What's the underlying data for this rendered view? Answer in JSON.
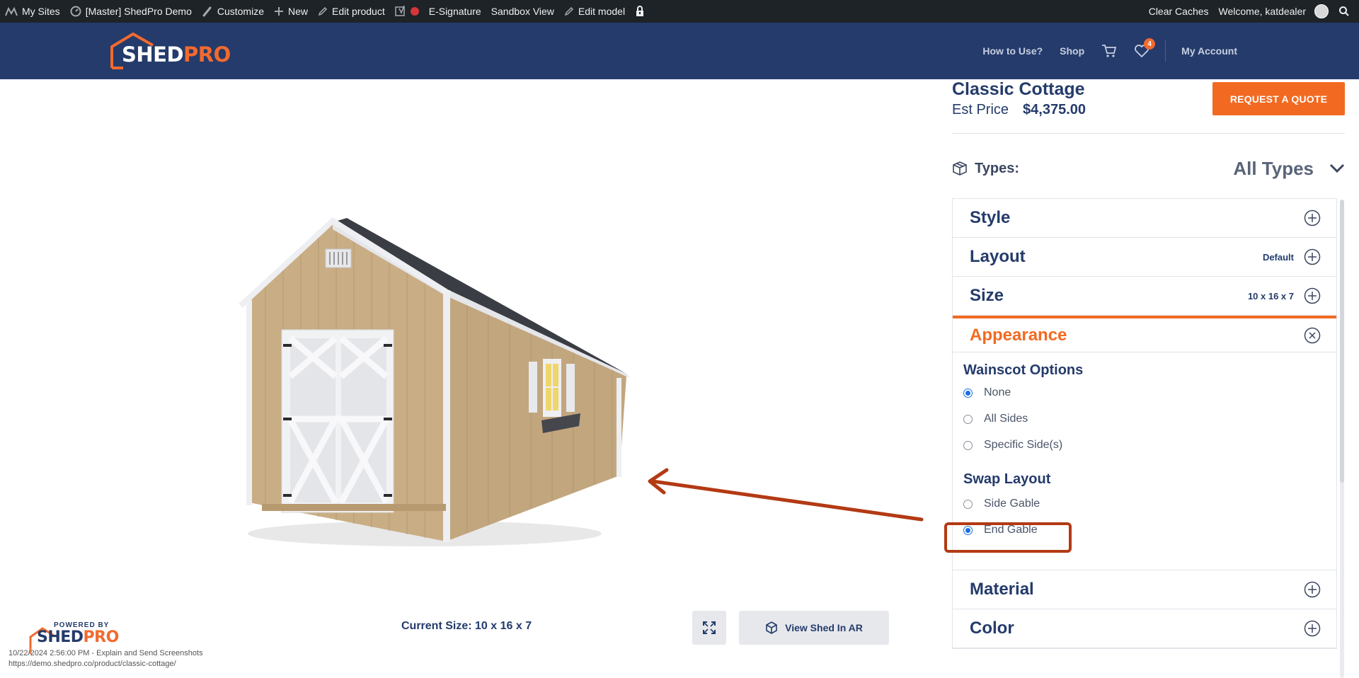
{
  "admin_bar": {
    "my_sites": "My Sites",
    "site_name": "[Master] ShedPro Demo",
    "customize": "Customize",
    "new": "New",
    "edit_product": "Edit product",
    "esignature": "E-Signature",
    "sandbox_view": "Sandbox View",
    "edit_model": "Edit model",
    "clear_caches": "Clear Caches",
    "welcome": "Welcome, katdealer"
  },
  "header": {
    "logo_main": "SHED",
    "logo_accent": "PRO",
    "nav": {
      "how_to_use": "How to Use?",
      "shop": "Shop",
      "wishlist_count": "4",
      "my_account": "My Account"
    }
  },
  "product": {
    "title": "Classic Cottage",
    "est_label": "Est Price",
    "est_price": "$4,375.00",
    "quote_button": "REQUEST A QUOTE",
    "types_label": "Types:",
    "types_value": "All Types"
  },
  "accordion": {
    "style": {
      "title": "Style"
    },
    "layout": {
      "title": "Layout",
      "value": "Default"
    },
    "size": {
      "title": "Size",
      "value": "10 x 16 x 7"
    },
    "appearance": {
      "title": "Appearance",
      "wainscot_heading": "Wainscot Options",
      "wainscot_options": [
        "None",
        "All Sides",
        "Specific Side(s)"
      ],
      "swap_heading": "Swap Layout",
      "swap_options": [
        "Side Gable",
        "End Gable"
      ]
    },
    "material": {
      "title": "Material"
    },
    "color": {
      "title": "Color"
    }
  },
  "viewer": {
    "current_size": "Current Size: 10 x 16 x 7",
    "view_ar": "View Shed In AR",
    "powered_by": "POWERED BY",
    "powered_logo_main": "SHED",
    "powered_logo_accent": "PRO"
  },
  "watermark": {
    "line1": "10/22/2024 2:56:00 PM - Explain and Send Screenshots",
    "line2": "https://demo.shedpro.co/product/classic-cottage/"
  },
  "colors": {
    "brand_navy": "#243b6b",
    "accent_orange": "#f26a21",
    "annotation": "#b33a14"
  }
}
